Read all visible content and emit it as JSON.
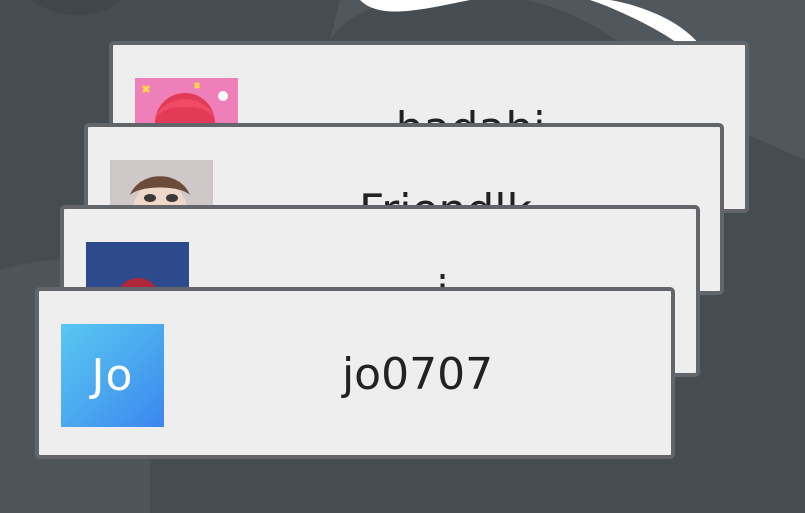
{
  "accounts": [
    {
      "name": "hadahi...",
      "avatar": "anime-girl-avatar",
      "accent": "#ee7fb8"
    },
    {
      "name": "Friendlk...",
      "avatar": "cartoon-face-avatar",
      "accent": "#c8bfbf"
    },
    {
      "name": "...i...",
      "avatar": "logo-avatar",
      "accent": "#2d4a8c"
    },
    {
      "name": "jo0707",
      "avatar": "initials-avatar",
      "initials": "Jo",
      "accent": "#3a86f0"
    }
  ],
  "colors": {
    "background": "#454c52",
    "card": "#eeeeee",
    "card_border": "#62666a",
    "text": "#222222"
  }
}
